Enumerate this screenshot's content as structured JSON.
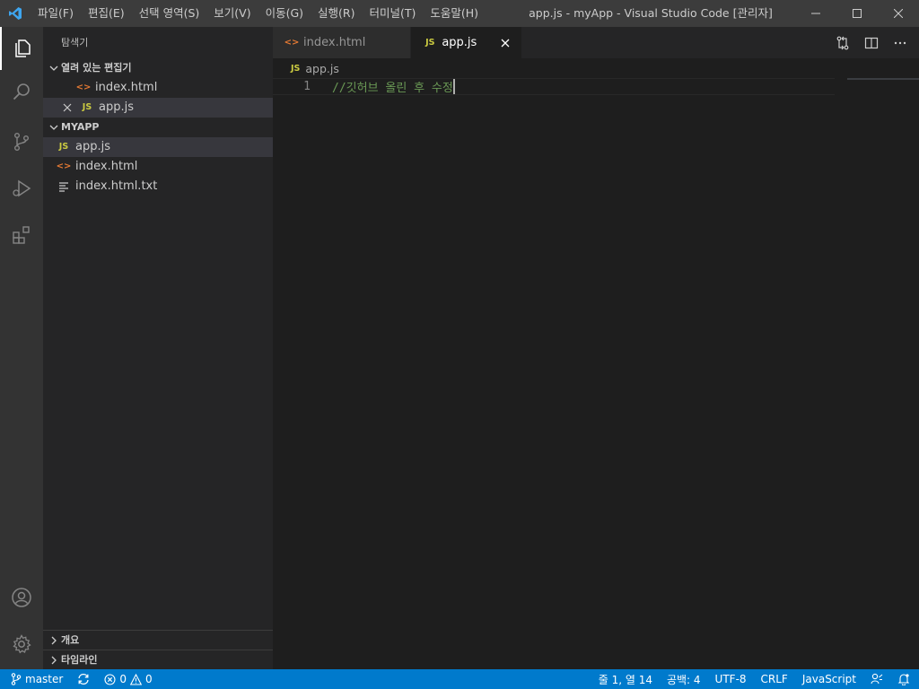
{
  "titlebar": {
    "menu": [
      "파일(F)",
      "편집(E)",
      "선택 영역(S)",
      "보기(V)",
      "이동(G)",
      "실행(R)",
      "터미널(T)",
      "도움말(H)"
    ],
    "window_title": "app.js - myApp - Visual Studio Code [관리자]"
  },
  "sidebar": {
    "title": "탐색기",
    "open_editors": {
      "label": "열려 있는 편집기",
      "items": [
        {
          "name": "index.html",
          "icon": "html-file-icon"
        },
        {
          "name": "app.js",
          "icon": "js-file-icon"
        }
      ]
    },
    "project": {
      "label": "MYAPP",
      "files": [
        {
          "name": "app.js",
          "icon": "js-file-icon"
        },
        {
          "name": "index.html",
          "icon": "html-file-icon"
        },
        {
          "name": "index.html.txt",
          "icon": "text-file-icon"
        }
      ]
    },
    "outline_label": "개요",
    "timeline_label": "타임라인"
  },
  "icons": {
    "js_badge": "JS",
    "html_badge": "<>"
  },
  "tabs": [
    {
      "label": "index.html",
      "active": false
    },
    {
      "label": "app.js",
      "active": true
    }
  ],
  "breadcrumb": {
    "file": "app.js"
  },
  "editor": {
    "lines": [
      {
        "number": "1",
        "text": "//깃허브 올린 후 수정"
      }
    ]
  },
  "statusbar": {
    "branch": "master",
    "errors": "0",
    "warnings": "0",
    "position": "줄 1, 열 14",
    "spaces": "공백: 4",
    "encoding": "UTF-8",
    "eol": "CRLF",
    "language": "JavaScript"
  },
  "colors": {
    "accent": "#007acc",
    "comment": "#6a9955",
    "titlebar": "#3c3c3c",
    "sidebar": "#252526",
    "editor": "#1e1e1e"
  }
}
